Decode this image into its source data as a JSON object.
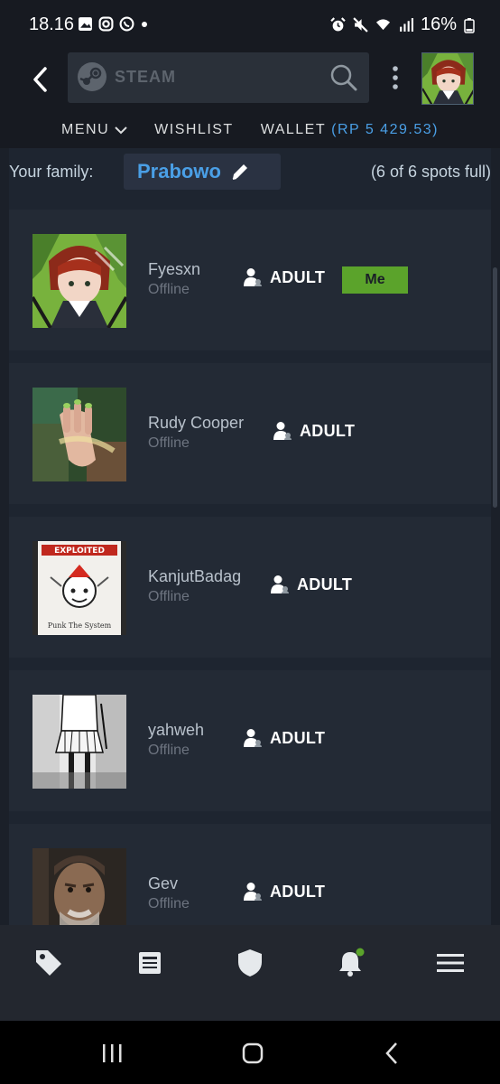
{
  "status_bar": {
    "time": "18.16",
    "left_icons": [
      "gallery-icon",
      "instagram-icon",
      "whatsapp-icon",
      "dot-icon"
    ],
    "right_icons": [
      "alarm-icon",
      "mute-icon",
      "wifi-icon",
      "signal-icon",
      "battery-icon"
    ],
    "battery": "16%"
  },
  "header": {
    "search_brand": "STEAM",
    "back_icon": "chevron-left-icon",
    "search_icon": "search-icon",
    "menu_icon": "kebab-icon"
  },
  "nav": {
    "menu": "MENU",
    "wishlist": "WISHLIST",
    "wallet_label": "WALLET",
    "wallet_amount": "(RP 5 429.53)"
  },
  "family": {
    "label": "Your family:",
    "name": "Prabowo",
    "count": "(6 of 6 spots full)"
  },
  "members": [
    {
      "name": "Fyesxn",
      "status": "Offline",
      "role": "ADULT",
      "badge": "Me"
    },
    {
      "name": "Rudy Cooper",
      "status": "Offline",
      "role": "ADULT"
    },
    {
      "name": "KanjutBadag",
      "status": "Offline",
      "role": "ADULT"
    },
    {
      "name": "yahweh",
      "status": "Offline",
      "role": "ADULT"
    },
    {
      "name": "Gev",
      "status": "Offline",
      "role": "ADULT"
    }
  ],
  "avatar_texts": {
    "kanjut_top": "EXPLOITED",
    "kanjut_bottom": "Punk The System"
  },
  "tabbar": {
    "items": [
      "tag-icon",
      "news-icon",
      "shield-icon",
      "bell-icon",
      "hamburger-icon"
    ],
    "notification_color": "#5ba32b"
  },
  "colors": {
    "accent_blue": "#4a9fe6",
    "me_badge": "#5ba32b",
    "background": "#171a21"
  }
}
